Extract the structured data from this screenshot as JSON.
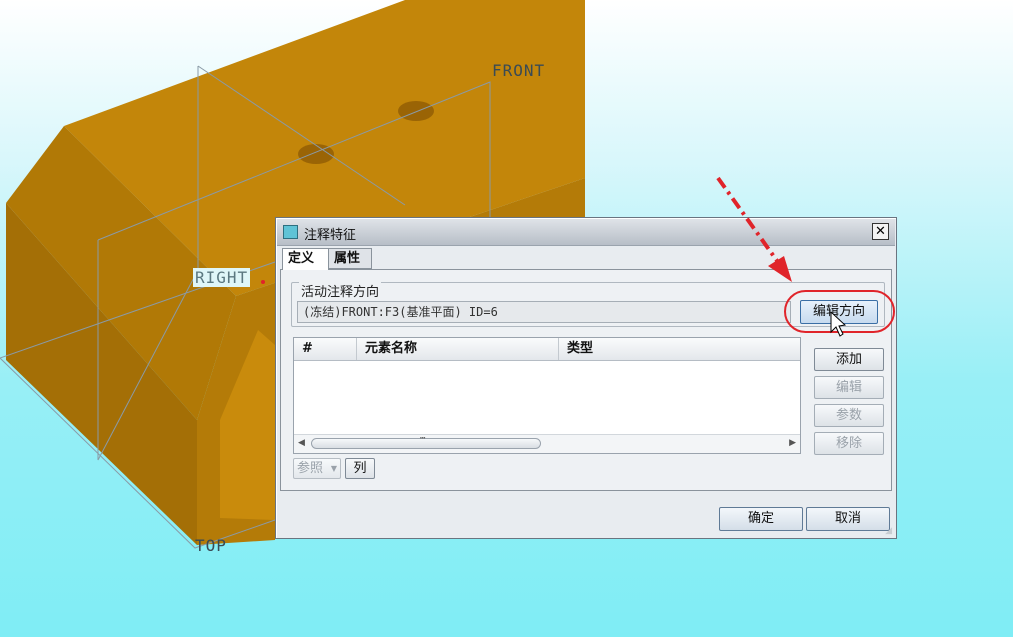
{
  "scene": {
    "datum_labels": {
      "front": "FRONT",
      "right": "RIGHT",
      "top": "TOP"
    },
    "colors": {
      "part": "#c3860a",
      "part_shadow": "#a46f06",
      "datum_line": "#8a9aa6"
    }
  },
  "dialog": {
    "title": "注释特征",
    "close_glyph": "✕",
    "tabs": [
      {
        "label": "定义",
        "active": true
      },
      {
        "label": "属性",
        "active": false
      }
    ],
    "direction_group": {
      "title": "活动注释方向",
      "value": "(冻结)FRONT:F3(基准平面) ID=6",
      "edit_button": "编辑方向"
    },
    "table": {
      "columns": [
        "#",
        "元素名称",
        "类型"
      ],
      "rows": [],
      "scroll_grip": "┅"
    },
    "side_buttons": {
      "add": "添加",
      "edit": "编辑",
      "params": "参数",
      "remove": "移除"
    },
    "references_button": "参照",
    "columns_button": "列",
    "ok_button": "确定",
    "cancel_button": "取消"
  },
  "annotation_color": "#e0242a"
}
